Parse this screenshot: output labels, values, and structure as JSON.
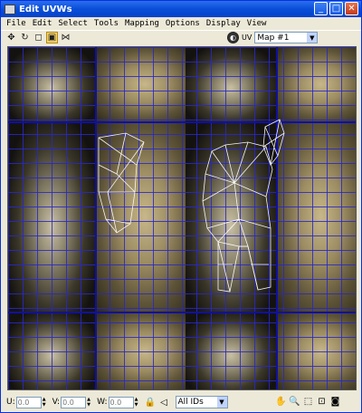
{
  "window": {
    "title": "Edit UVWs"
  },
  "menu": [
    "File",
    "Edit",
    "Select",
    "Tools",
    "Mapping",
    "Options",
    "Display",
    "View"
  ],
  "toolbar": {
    "uv_label": "UV",
    "map_value": "Map #1"
  },
  "bottom": {
    "u_label": "U:",
    "u_value": "0.0",
    "v_label": "V:",
    "v_value": "0.0",
    "w_label": "W:",
    "w_value": "0.0",
    "ids_value": "All IDs"
  },
  "colors": {
    "grid": "#2828c8",
    "mesh": "#ffffff",
    "titlebar": "#0a4ed8"
  },
  "icons": {
    "move": "move-icon",
    "rotate": "rotate-icon",
    "scale": "scale-icon",
    "freeform": "freeform-icon",
    "mirror": "mirror-icon",
    "pan": "hand-icon",
    "zoom": "zoom-icon",
    "zoom_region": "zoom-region-icon",
    "zoom_extents": "zoom-extents-icon",
    "texture": "texture-icon"
  }
}
